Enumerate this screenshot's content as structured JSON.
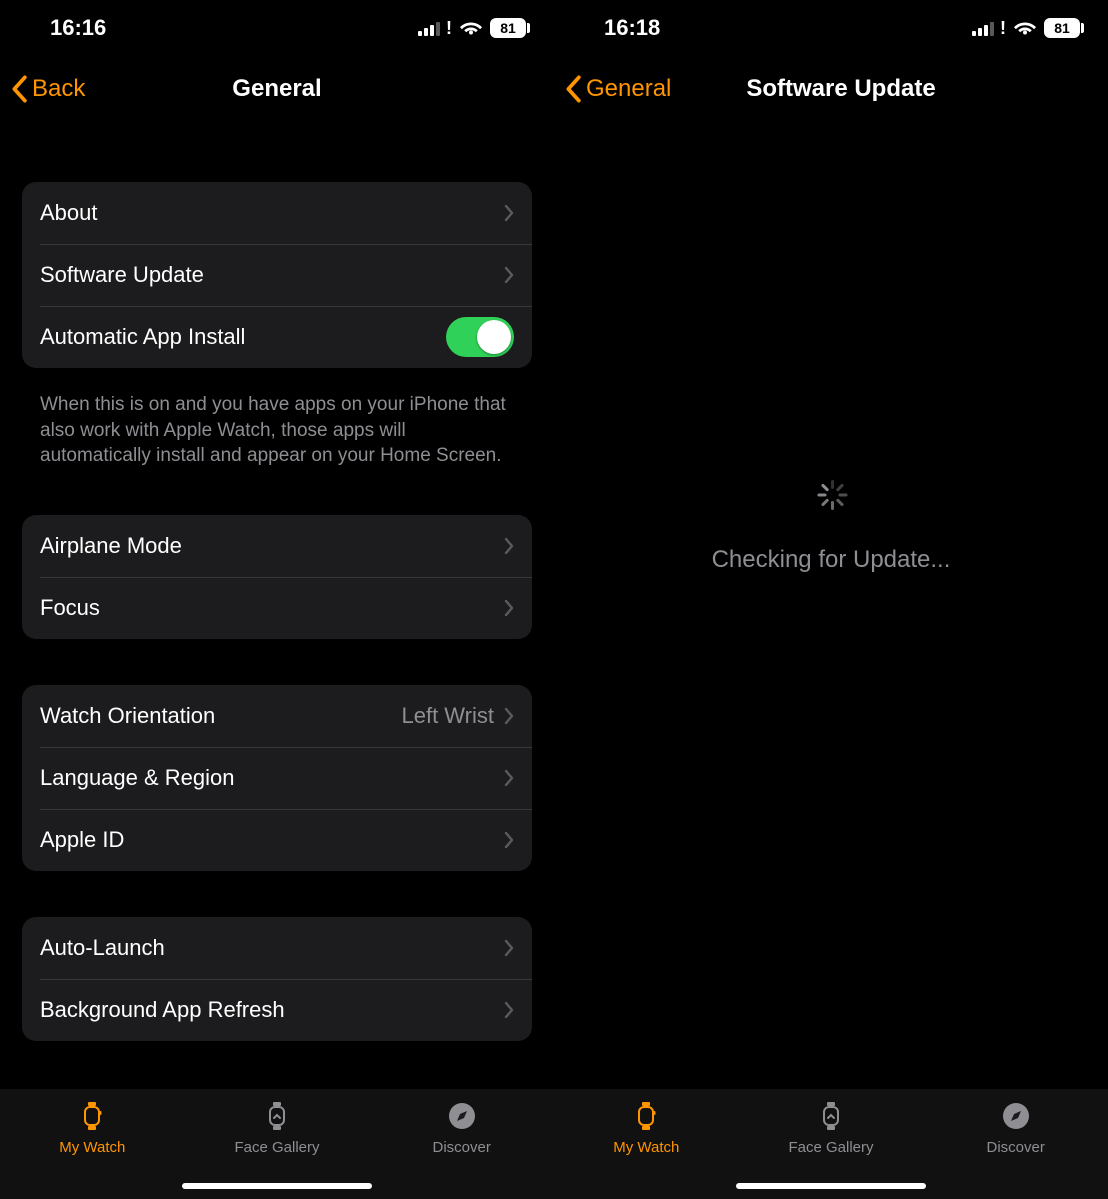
{
  "left": {
    "status": {
      "time": "16:16",
      "battery": "81"
    },
    "nav": {
      "back": "Back",
      "title": "General"
    },
    "group1": {
      "about": "About",
      "software_update": "Software Update",
      "auto_install": "Automatic App Install"
    },
    "footer1": "When this is on and you have apps on your iPhone that also work with Apple Watch, those apps will automatically install and appear on your Home Screen.",
    "group2": {
      "airplane": "Airplane Mode",
      "focus": "Focus"
    },
    "group3": {
      "orientation": "Watch Orientation",
      "orientation_value": "Left Wrist",
      "language": "Language & Region",
      "apple_id": "Apple ID"
    },
    "group4": {
      "auto_launch": "Auto-Launch",
      "bg_refresh": "Background App Refresh"
    }
  },
  "right": {
    "status": {
      "time": "16:18",
      "battery": "81"
    },
    "nav": {
      "back": "General",
      "title": "Software Update"
    },
    "loading": "Checking for Update..."
  },
  "tabs": {
    "my_watch": "My Watch",
    "face_gallery": "Face Gallery",
    "discover": "Discover"
  }
}
